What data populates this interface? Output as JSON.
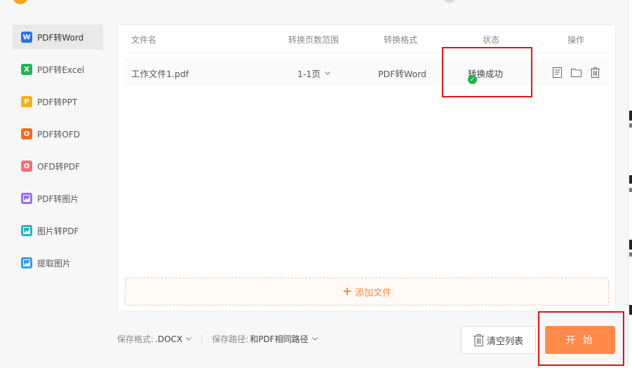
{
  "sidebar": {
    "items": [
      {
        "label": "PDF转Word",
        "icon": "word-icon",
        "glyph": "W",
        "color": "#2b6fe8"
      },
      {
        "label": "PDF转Excel",
        "icon": "excel-icon",
        "glyph": "X",
        "color": "#1fb45a"
      },
      {
        "label": "PDF转PPT",
        "icon": "ppt-icon",
        "glyph": "P",
        "color": "#f5b11c"
      },
      {
        "label": "PDF转OFD",
        "icon": "ofd-icon",
        "glyph": "O",
        "color": "#f26b1d"
      },
      {
        "label": "OFD转PDF",
        "icon": "ofd-to-pdf-icon",
        "glyph": "O",
        "color": "#f0707e"
      },
      {
        "label": "PDF转图片",
        "icon": "pdf-to-image-icon",
        "glyph": "▣",
        "color": "#9b6cf0"
      },
      {
        "label": "图片转PDF",
        "icon": "image-to-pdf-icon",
        "glyph": "▣",
        "color": "#1fb6c8"
      },
      {
        "label": "提取图片",
        "icon": "extract-image-icon",
        "glyph": "▣",
        "color": "#2f9ef0"
      }
    ]
  },
  "table": {
    "headers": {
      "filename": "文件名",
      "page_range": "转换页数范围",
      "format": "转换格式",
      "status": "状态",
      "actions": "操作"
    },
    "rows": [
      {
        "filename": "工作文件1.pdf",
        "page_range": "1-1页",
        "format": "PDF转Word",
        "status": "转换成功"
      }
    ]
  },
  "add_file": {
    "label": "添加文件"
  },
  "bottom": {
    "format_label": "保存格式:",
    "format_value": ".DOCX",
    "path_label": "保存路径:",
    "path_value": "和PDF相同路径",
    "clear_label": "清空列表",
    "start_label": "开 始"
  },
  "colors": {
    "accent": "#ff8a4a",
    "success": "#22b04b",
    "highlight": "#d9161b"
  }
}
